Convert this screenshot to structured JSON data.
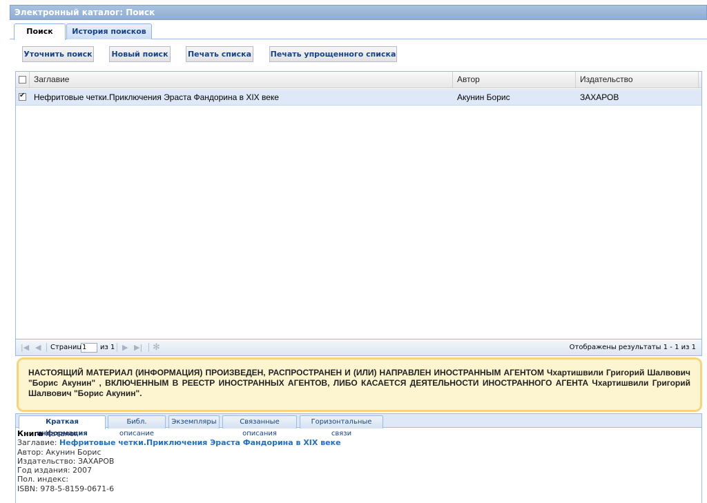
{
  "window": {
    "title": "Электронный каталог: Поиск"
  },
  "tabs": [
    {
      "label": "Поиск"
    },
    {
      "label": "История поисков"
    }
  ],
  "toolbar": {
    "refine": "Уточнить поиск",
    "new": "Новый поиск",
    "print": "Печать списка",
    "print_simple": "Печать упрощенного списка"
  },
  "grid": {
    "columns": [
      "Заглавие",
      "Автор",
      "Издательство"
    ],
    "rows": [
      {
        "checked": true,
        "title": "Нефритовые четки.Приключения Эраста Фандорина в XIX веке",
        "author": "Акунин Борис",
        "publisher": "ЗАХАРОВ"
      }
    ]
  },
  "pager": {
    "page_label": "Страница",
    "page_value": "1",
    "of_label": "из 1",
    "results": "Отображены результаты 1 - 1 из 1"
  },
  "warning": "НАСТОЯЩИЙ МАТЕРИАЛ (ИНФОРМАЦИЯ) ПРОИЗВЕДЕН, РАСПРОСТРАНЕН И (ИЛИ) НАПРАВЛЕН ИНОСТРАННЫМ АГЕНТОМ Чхартишвили Григорий Шалвович \"Борис Акунин\" , ВКЛЮЧЕННЫМ В РЕЕСТР ИНОСТРАННЫХ АГЕНТОВ, ЛИБО КАСАЕТСЯ ДЕЯТЕЛЬНОСТИ ИНОСТРАННОГО АГЕНТА Чхартишвили Григорий Шалвович \"Борис Акунин\".",
  "detail_tabs": [
    "Краткая информация",
    "Библ. описание",
    "Экземпляры",
    "Связанные описания",
    "Горизонтальные связи"
  ],
  "info": {
    "type_bold": "Книга",
    "type_rest": " Каталог",
    "title_label": "Заглавие: ",
    "title_value": "Нефритовые четки.Приключения Эраста Фандорина в XIX веке",
    "author": "Автор: Акунин Борис",
    "publisher": "Издательство: ЗАХАРОВ",
    "year": "Год издания: 2007",
    "index": "Пол. индекс:",
    "isbn": "ISBN: 978-5-8159-0671-6"
  },
  "colors": {
    "accent": "#15428b",
    "header": "#99bbe8",
    "warning_bg": "#fcf5d0",
    "warning_border": "#f6d47c",
    "link": "#1f6fc8"
  }
}
